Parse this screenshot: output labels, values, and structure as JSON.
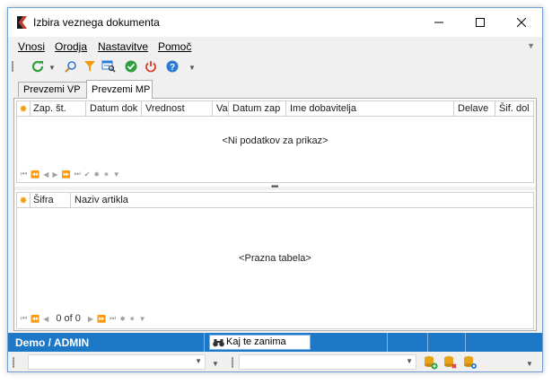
{
  "window": {
    "title": "Izbira veznega dokumenta"
  },
  "menu": {
    "items": [
      "Vnosi",
      "Orodja",
      "Nastavitve",
      "Pomoč"
    ]
  },
  "toolbar": {
    "icons": [
      "refresh-icon",
      "search-icon",
      "filter-icon",
      "report-icon",
      "ok-icon",
      "power-icon",
      "help-icon"
    ]
  },
  "tabs": {
    "vp_label": "Prevzemi VP",
    "mp_label": "Prevzemi MP",
    "active": "Prevzemi MP"
  },
  "top_grid": {
    "columns": [
      "Zap. št.",
      "Datum dok",
      "Vrednost",
      "Va",
      "Datum zap",
      "Ime dobavitelja",
      "Delave",
      "Šif. dol"
    ],
    "empty_text": "<Ni podatkov za prikaz>"
  },
  "bottom_grid": {
    "columns": [
      "Šifra",
      "Naziv artikla"
    ],
    "empty_text": "<Prazna tabela>",
    "record_count": "0 of 0"
  },
  "status": {
    "title": "Demo / ADMIN",
    "search_text": "Kaj te zanima"
  },
  "colors": {
    "status_bar": "#1e78c8",
    "accent": "#f39c12"
  }
}
